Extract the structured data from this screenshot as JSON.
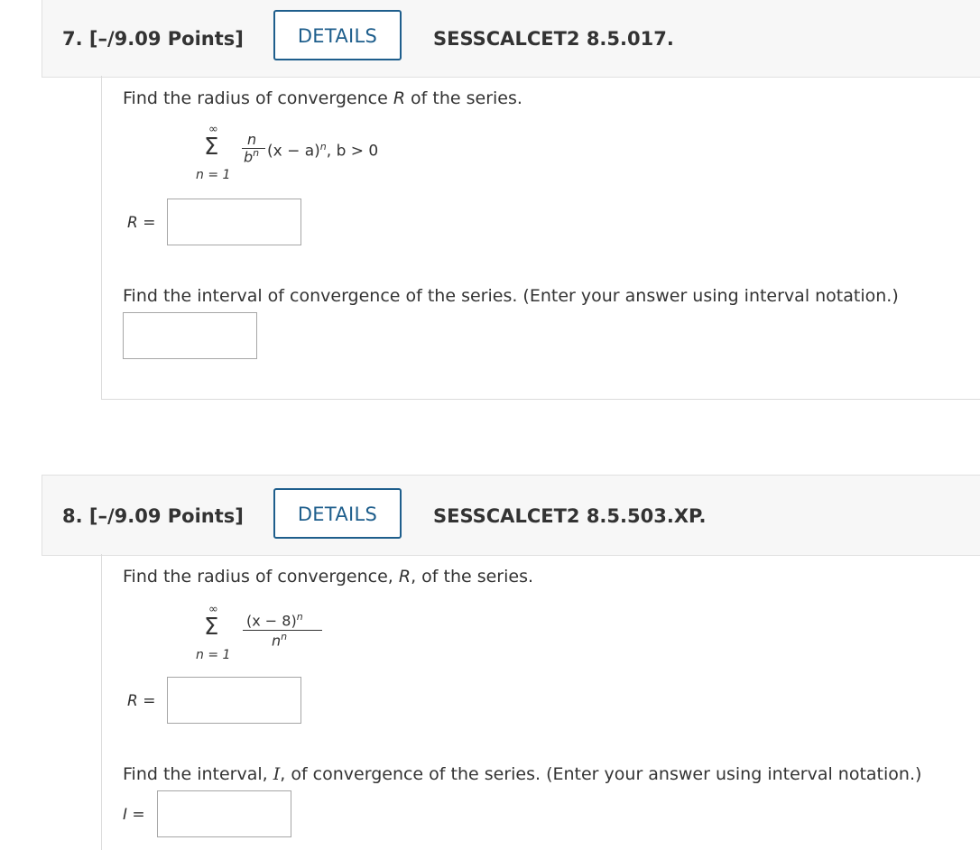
{
  "questions": [
    {
      "number_points": "7. [–/9.09 Points]",
      "details_label": "DETAILS",
      "code": "SESSCALCET2 8.5.017.",
      "prompt1_pre": "Find the radius of convergence ",
      "prompt1_var": "R",
      "prompt1_post": " of the series.",
      "series": {
        "upper": "∞",
        "sigma": "Σ",
        "lower": "n = 1",
        "numerator": "n",
        "denominator": "b",
        "denominator_exp": "n",
        "tail_pre": "(x − a)",
        "tail_exp": "n",
        "tail_post": ", b > 0"
      },
      "answer1_label": "R =",
      "answer1_value": "",
      "prompt2": "Find the interval of convergence of the series. (Enter your answer using interval notation.)",
      "answer2_label": "",
      "answer2_value": ""
    },
    {
      "number_points": "8. [–/9.09 Points]",
      "details_label": "DETAILS",
      "code": "SESSCALCET2 8.5.503.XP.",
      "prompt1_pre": "Find the radius of convergence, ",
      "prompt1_var": "R",
      "prompt1_post": ", of the series.",
      "series": {
        "upper": "∞",
        "sigma": "Σ",
        "lower": "n = 1",
        "numerator": "(x − 8)",
        "numerator_exp": "n",
        "denominator": "n",
        "denominator_exp": "n"
      },
      "answer1_label": "R =",
      "answer1_value": "",
      "prompt2_pre": "Find the interval, ",
      "prompt2_var": "I",
      "prompt2_post": ", of convergence of the series. (Enter your answer using interval notation.)",
      "answer2_label": "I =",
      "answer2_value": ""
    }
  ]
}
